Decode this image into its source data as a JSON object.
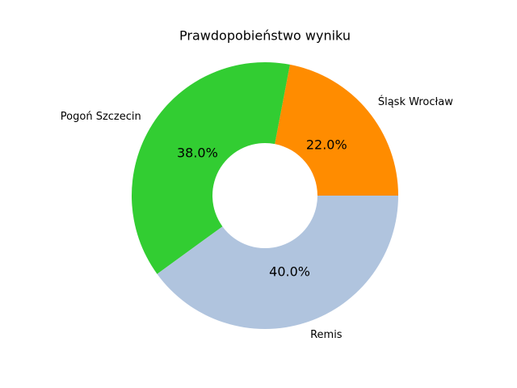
{
  "chart_data": {
    "type": "pie",
    "title": "Prawdopobieństwo wyniku",
    "donut": true,
    "start_angle_deg": 0,
    "direction": "counterclockwise",
    "slices": [
      {
        "label": "Śląsk Wrocław",
        "value": 22.0,
        "pct_label": "22.0%",
        "color": "#ff8c00"
      },
      {
        "label": "Pogoń Szczecin",
        "value": 38.0,
        "pct_label": "38.0%",
        "color": "#32cd32"
      },
      {
        "label": "Remis",
        "value": 40.0,
        "pct_label": "40.0%",
        "color": "#b0c4de"
      }
    ]
  }
}
